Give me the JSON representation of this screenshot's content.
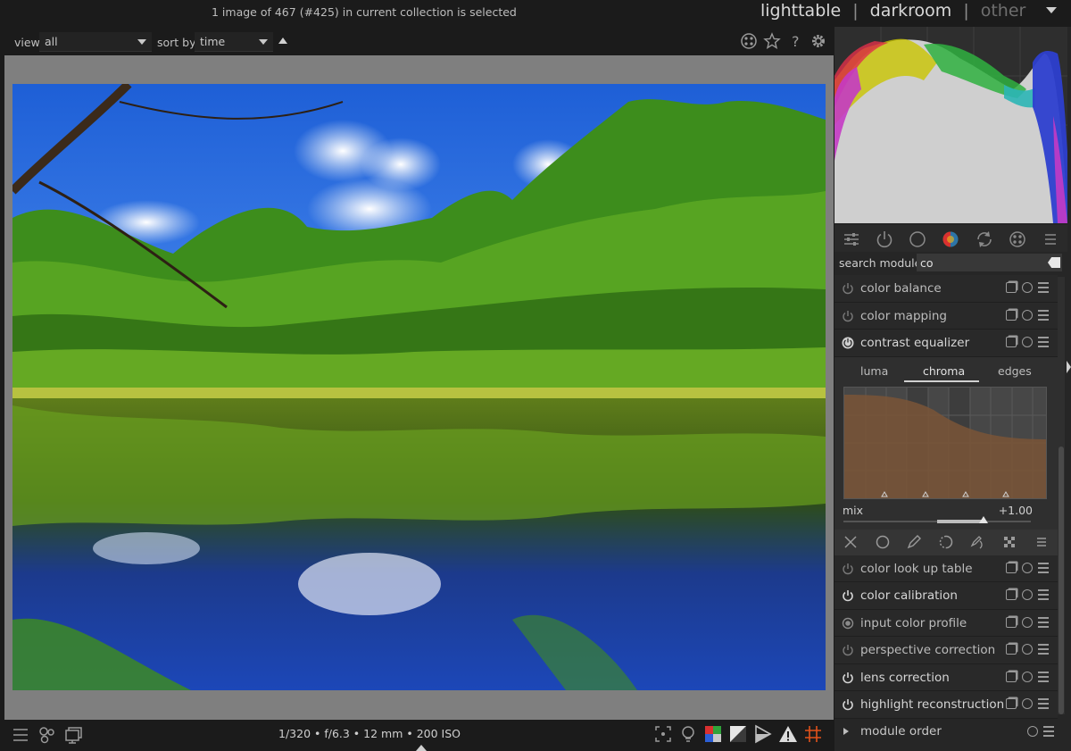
{
  "header": {
    "status": "1 image of 467 (#425) in current collection is selected",
    "views": [
      "lighttable",
      "darkroom",
      "other"
    ],
    "separator": "|"
  },
  "filterbar": {
    "view_label": "view",
    "view_value": "all",
    "sort_label": "sort by",
    "sort_value": "time",
    "icons": [
      "grouping-icon",
      "star-icon",
      "help-icon",
      "gear-icon"
    ]
  },
  "bottombar": {
    "exif": "1/320 • f/6.3 • 12 mm • 200 ISO",
    "left_icons": [
      "presets-icon",
      "styles-icon",
      "second-window-icon"
    ],
    "right_icons": [
      "focus-peaking-icon",
      "lightbulb-icon",
      "softproof-icon",
      "gamut-check-icon",
      "raw-overexposed-icon",
      "clipping-warning-icon",
      "guides-icon"
    ]
  },
  "right_panel": {
    "module_group_icons": [
      "quick-access-icon",
      "active-modules-icon",
      "base-icon",
      "color-icon",
      "correct-icon",
      "effect-icon",
      "menu-icon"
    ],
    "search_label": "search module",
    "search_value": "co",
    "modules_top": [
      {
        "name": "color balance",
        "enabled": false
      },
      {
        "name": "color mapping",
        "enabled": false
      },
      {
        "name": "contrast equalizer",
        "enabled": true
      }
    ],
    "tabs": [
      "luma",
      "chroma",
      "edges"
    ],
    "active_tab": "chroma",
    "mix_label": "mix",
    "mix_value": "+1.00",
    "mix_fraction": 1.0,
    "blend_icons": [
      "blend-off-icon",
      "blend-uniform-icon",
      "blend-drawn-icon",
      "blend-parametric-icon",
      "blend-drawn-parametric-icon",
      "blend-raster-icon",
      "menu-icon"
    ],
    "modules_bottom": [
      {
        "name": "color look up table",
        "enabled": false
      },
      {
        "name": "color calibration",
        "enabled": true
      },
      {
        "name": "input color profile",
        "enabled": true
      },
      {
        "name": "perspective correction",
        "enabled": false
      },
      {
        "name": "lens correction",
        "enabled": true
      },
      {
        "name": "highlight reconstruction",
        "enabled": true
      }
    ],
    "module_order": "module order"
  },
  "colors": {
    "panel_bg": "#262626",
    "center_bg": "#7f7f7f",
    "eq_curve": "#7a5537"
  }
}
